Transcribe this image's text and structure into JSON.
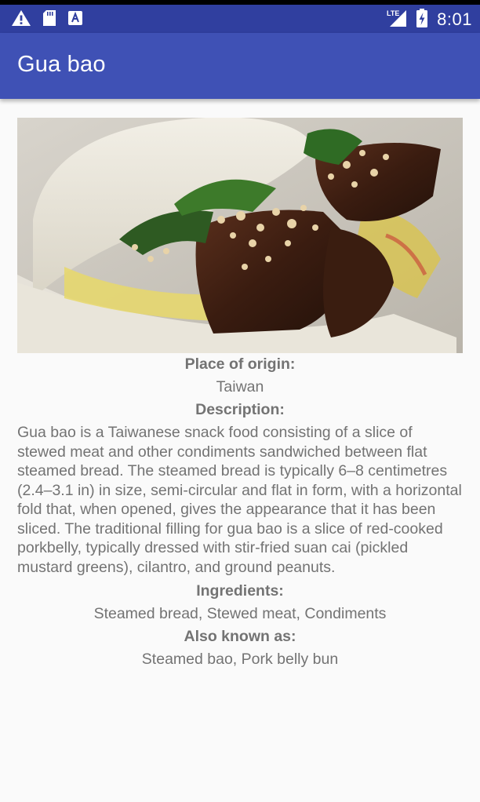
{
  "status_bar": {
    "time": "8:01",
    "lte_label": "LTE",
    "notification_icons": [
      "warning-icon",
      "sd-card-icon",
      "a-icon"
    ],
    "system_icons": [
      "lte-signal-icon",
      "battery-charging-icon"
    ]
  },
  "app_bar": {
    "title": "Gua bao"
  },
  "food": {
    "image_alt": "Gua bao",
    "place_of_origin_label": "Place of origin:",
    "place_of_origin": "Taiwan",
    "description_label": "Description:",
    "description": "Gua bao is a Taiwanese snack food consisting of a slice of stewed meat and other condiments sandwiched between flat steamed bread. The steamed bread is typically 6–8 centimetres (2.4–3.1 in) in size, semi-circular and flat in form, with a horizontal fold that, when opened, gives the appearance that it has been sliced. The traditional filling for gua bao is a slice of red-cooked porkbelly, typically dressed with stir-fried suan cai (pickled mustard greens), cilantro, and ground peanuts.",
    "ingredients_label": "Ingredients:",
    "ingredients": "Steamed bread, Stewed meat, Condiments",
    "also_known_as_label": "Also known as:",
    "also_known_as": "Steamed bao, Pork belly bun"
  },
  "colors": {
    "status_bar": "#303f9f",
    "app_bar": "#3f51b5",
    "text": "#737373",
    "background": "#fafafa"
  }
}
